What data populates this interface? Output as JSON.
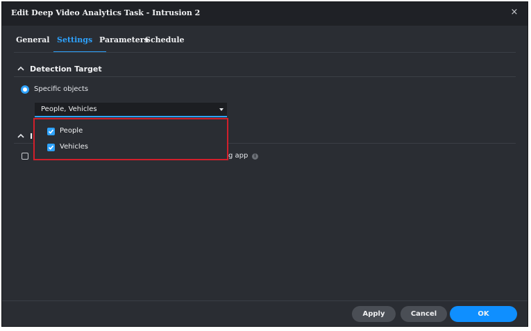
{
  "dialog": {
    "title": "Edit Deep Video Analytics Task - Intrusion 2",
    "close_icon": "×"
  },
  "tabs": [
    {
      "label": "General",
      "active": false
    },
    {
      "label": "Settings",
      "active": true
    },
    {
      "label": "Parameters",
      "active": false
    },
    {
      "label": "Schedule",
      "active": false
    }
  ],
  "detection_target": {
    "header": "Detection Target",
    "radio_label": "Specific objects",
    "selected_value": "People, Vehicles",
    "options": [
      {
        "label": "People",
        "checked": true
      },
      {
        "label": "Vehicles",
        "checked": true
      }
    ]
  },
  "second_section": {
    "header_fragment": "I",
    "checkbox_text_fragment": "g app"
  },
  "footer": {
    "apply_label": "Apply",
    "cancel_label": "Cancel",
    "ok_label": "OK"
  },
  "colors": {
    "accent": "#2ea3ff",
    "highlight_border": "#d21f2b",
    "dialog_bg": "#2a2d33",
    "titlebar_bg": "#1f2126"
  }
}
